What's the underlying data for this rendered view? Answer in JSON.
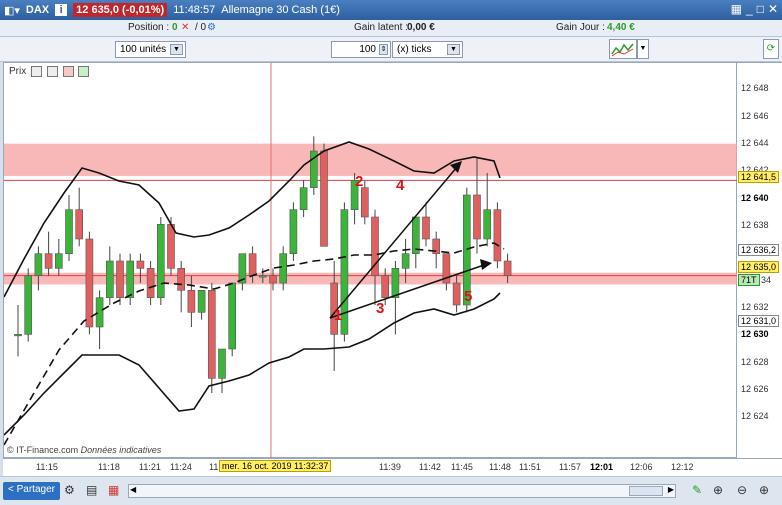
{
  "titlebar": {
    "menu_icon": "chart-menu-icon",
    "instrument": "DAX",
    "price_badge": "12 635,0 (-0,01%)",
    "time": "11:48:57",
    "name": "Allemagne 30 Cash (1€)"
  },
  "positionbar": {
    "position_label": "Position :",
    "position_value": "0",
    "position_slash": "/ 0",
    "gain_latent_label": "Gain latent :",
    "gain_latent_value": "0,00 €",
    "gain_jour_label": "Gain Jour :",
    "gain_jour_value": "4,40 €"
  },
  "controls": {
    "units_select": "100 unités",
    "ticks_value": "100",
    "ticks_select": "(x) ticks"
  },
  "chart": {
    "prix_label": "Prix",
    "watermark": "© IT-Finance.com",
    "watermark_italic": "Données indicatives",
    "annotations": [
      "1",
      "2",
      "3",
      "4",
      "5"
    ]
  },
  "yaxis": {
    "ticks": [
      "12 648",
      "12 646",
      "12 644",
      "12 642",
      "12 640",
      "12 638",
      "12 636,2",
      "12 635,0",
      "34",
      "12 632",
      "12 631,0",
      "12 630",
      "12 628",
      "12 626",
      "12 624"
    ],
    "badge_upper": "12 641,5",
    "badge_current": "12 635,0",
    "badge_71t": "71T"
  },
  "xaxis": {
    "ticks": [
      "11:15",
      "11:18",
      "11:21",
      "11:24",
      "11",
      "11:39",
      "11:42",
      "11:45",
      "11:48",
      "11:51",
      "11:57",
      "12:01",
      "12:06",
      "12:12"
    ],
    "cursor_label": "mer. 16 oct. 2019 11:32:37"
  },
  "bottom": {
    "share_label": "Partager"
  },
  "colors": {
    "up": "#3cb43c",
    "down": "#e06060",
    "zone": "#f5a0a0",
    "annotation": "#d9131b"
  },
  "chart_data": {
    "type": "candlestick",
    "ylim": [
      12622.5,
      12649.5
    ],
    "candles": [
      {
        "o": 12631,
        "h": 12633,
        "l": 12629.5,
        "c": 12631
      },
      {
        "o": 12631,
        "h": 12635.5,
        "l": 12630.5,
        "c": 12635
      },
      {
        "o": 12635,
        "h": 12637,
        "l": 12634,
        "c": 12636.5
      },
      {
        "o": 12636.5,
        "h": 12638,
        "l": 12635,
        "c": 12635.5
      },
      {
        "o": 12635.5,
        "h": 12637.5,
        "l": 12635,
        "c": 12636.5
      },
      {
        "o": 12636.5,
        "h": 12640.5,
        "l": 12636,
        "c": 12639.5
      },
      {
        "o": 12639.5,
        "h": 12641,
        "l": 12637,
        "c": 12637.5
      },
      {
        "o": 12637.5,
        "h": 12638,
        "l": 12631,
        "c": 12631.5
      },
      {
        "o": 12631.5,
        "h": 12634,
        "l": 12630,
        "c": 12633.5
      },
      {
        "o": 12633.5,
        "h": 12637,
        "l": 12633,
        "c": 12636
      },
      {
        "o": 12636,
        "h": 12636.5,
        "l": 12633,
        "c": 12633.5
      },
      {
        "o": 12633.5,
        "h": 12636.5,
        "l": 12633,
        "c": 12636
      },
      {
        "o": 12636,
        "h": 12636.5,
        "l": 12634.5,
        "c": 12635.5
      },
      {
        "o": 12635.5,
        "h": 12636,
        "l": 12633,
        "c": 12633.5
      },
      {
        "o": 12633.5,
        "h": 12639,
        "l": 12633,
        "c": 12638.5
      },
      {
        "o": 12638.5,
        "h": 12639,
        "l": 12635,
        "c": 12635.5
      },
      {
        "o": 12635.5,
        "h": 12636,
        "l": 12632.5,
        "c": 12634
      },
      {
        "o": 12634,
        "h": 12635,
        "l": 12631.5,
        "c": 12632.5
      },
      {
        "o": 12632.5,
        "h": 12634,
        "l": 12632,
        "c": 12634
      },
      {
        "o": 12634,
        "h": 12634.5,
        "l": 12627,
        "c": 12628
      },
      {
        "o": 12628,
        "h": 12630,
        "l": 12627,
        "c": 12630
      },
      {
        "o": 12630,
        "h": 12634.5,
        "l": 12629.5,
        "c": 12634.5
      },
      {
        "o": 12634.5,
        "h": 12636.5,
        "l": 12634,
        "c": 12636.5
      },
      {
        "o": 12636.5,
        "h": 12637,
        "l": 12634.5,
        "c": 12635
      },
      {
        "o": 12635,
        "h": 12635.5,
        "l": 12634.5,
        "c": 12635
      },
      {
        "o": 12635,
        "h": 12635.5,
        "l": 12634,
        "c": 12634.5
      },
      {
        "o": 12634.5,
        "h": 12637,
        "l": 12634,
        "c": 12636.5
      },
      {
        "o": 12636.5,
        "h": 12640,
        "l": 12636,
        "c": 12639.5
      },
      {
        "o": 12639.5,
        "h": 12641.5,
        "l": 12639,
        "c": 12641
      },
      {
        "o": 12641,
        "h": 12644.5,
        "l": 12640.5,
        "c": 12643.5
      },
      {
        "o": 12643.5,
        "h": 12644,
        "l": 12637,
        "c": 12637
      },
      {
        "o": 12634.5,
        "h": 12636,
        "l": 12628.5,
        "c": 12631
      },
      {
        "o": 12631,
        "h": 12640,
        "l": 12630.5,
        "c": 12639.5
      },
      {
        "o": 12639.5,
        "h": 12642,
        "l": 12638.5,
        "c": 12641.5
      },
      {
        "o": 12641,
        "h": 12641.5,
        "l": 12638.5,
        "c": 12639
      },
      {
        "o": 12639,
        "h": 12639.5,
        "l": 12633,
        "c": 12635
      },
      {
        "o": 12635,
        "h": 12635.5,
        "l": 12633,
        "c": 12633.5
      },
      {
        "o": 12633.5,
        "h": 12636,
        "l": 12631,
        "c": 12635.5
      },
      {
        "o": 12635.5,
        "h": 12637.5,
        "l": 12634.5,
        "c": 12636.5
      },
      {
        "o": 12636.5,
        "h": 12639,
        "l": 12635.5,
        "c": 12639
      },
      {
        "o": 12639,
        "h": 12640,
        "l": 12637,
        "c": 12637.5
      },
      {
        "o": 12637.5,
        "h": 12638,
        "l": 12635.5,
        "c": 12636.5
      },
      {
        "o": 12636.5,
        "h": 12636.5,
        "l": 12634,
        "c": 12634.5
      },
      {
        "o": 12634.5,
        "h": 12635,
        "l": 12632.5,
        "c": 12633
      },
      {
        "o": 12633,
        "h": 12641,
        "l": 12632.5,
        "c": 12640.5
      },
      {
        "o": 12640.5,
        "h": 12643,
        "l": 12636.5,
        "c": 12637.5
      },
      {
        "o": 12637.5,
        "h": 12642,
        "l": 12637,
        "c": 12639.5
      },
      {
        "o": 12639.5,
        "h": 12640,
        "l": 12635.5,
        "c": 12636
      },
      {
        "o": 12636,
        "h": 12636.5,
        "l": 12634.5,
        "c": 12635
      }
    ]
  }
}
